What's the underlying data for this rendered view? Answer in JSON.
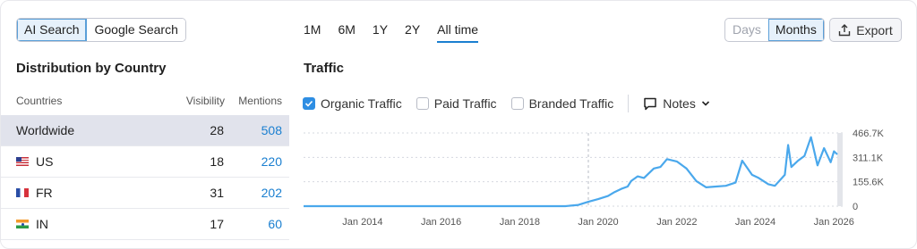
{
  "search_toggle": {
    "options": [
      "AI Search",
      "Google Search"
    ],
    "selected": "AI Search"
  },
  "left_panel": {
    "title": "Distribution by Country",
    "columns": [
      "Countries",
      "Visibility",
      "Mentions"
    ],
    "rows": [
      {
        "flag": "none",
        "country": "Worldwide",
        "visibility": "28",
        "mentions": "508",
        "selected": true
      },
      {
        "flag": "flag-us",
        "country": "US",
        "visibility": "18",
        "mentions": "220",
        "selected": false
      },
      {
        "flag": "flag-fr",
        "country": "FR",
        "visibility": "31",
        "mentions": "202",
        "selected": false
      },
      {
        "flag": "flag-in",
        "country": "IN",
        "visibility": "17",
        "mentions": "60",
        "selected": false
      }
    ]
  },
  "ranges": {
    "items": [
      "1M",
      "6M",
      "1Y",
      "2Y",
      "All time"
    ],
    "selected": "All time"
  },
  "granularity": {
    "options": [
      "Days",
      "Months"
    ],
    "selected": "Months"
  },
  "export_label": "Export",
  "traffic": {
    "title": "Traffic",
    "legend": [
      {
        "label": "Organic Traffic",
        "checked": true
      },
      {
        "label": "Paid Traffic",
        "checked": false
      },
      {
        "label": "Branded Traffic",
        "checked": false
      }
    ],
    "notes_label": "Notes"
  },
  "colors": {
    "accent": "#1a7fd0",
    "line": "#4aa8ec",
    "checkbox": "#2e8ee3"
  },
  "chart_data": {
    "type": "line",
    "title": "",
    "series": [
      {
        "name": "Organic Traffic",
        "points": [
          [
            "2012-07",
            0
          ],
          [
            "2013-06",
            0
          ],
          [
            "2014-06",
            0
          ],
          [
            "2015-06",
            0
          ],
          [
            "2016-06",
            0
          ],
          [
            "2017-06",
            0
          ],
          [
            "2018-06",
            0
          ],
          [
            "2019-03",
            0
          ],
          [
            "2019-07",
            8000
          ],
          [
            "2019-10",
            28000
          ],
          [
            "2020-01",
            45000
          ],
          [
            "2020-04",
            65000
          ],
          [
            "2020-06",
            90000
          ],
          [
            "2020-08",
            110000
          ],
          [
            "2020-10",
            125000
          ],
          [
            "2020-11",
            160000
          ],
          [
            "2021-01",
            190000
          ],
          [
            "2021-03",
            180000
          ],
          [
            "2021-06",
            240000
          ],
          [
            "2021-08",
            250000
          ],
          [
            "2021-10",
            300000
          ],
          [
            "2022-01",
            285000
          ],
          [
            "2022-04",
            240000
          ],
          [
            "2022-07",
            160000
          ],
          [
            "2022-10",
            120000
          ],
          [
            "2023-01",
            125000
          ],
          [
            "2023-04",
            130000
          ],
          [
            "2023-07",
            150000
          ],
          [
            "2023-09",
            290000
          ],
          [
            "2023-12",
            200000
          ],
          [
            "2024-02",
            180000
          ],
          [
            "2024-05",
            140000
          ],
          [
            "2024-07",
            130000
          ],
          [
            "2024-10",
            200000
          ],
          [
            "2024-11",
            390000
          ],
          [
            "2024-12",
            250000
          ],
          [
            "2025-02",
            290000
          ],
          [
            "2025-04",
            320000
          ],
          [
            "2025-06",
            440000
          ],
          [
            "2025-08",
            260000
          ],
          [
            "2025-10",
            370000
          ],
          [
            "2025-12",
            280000
          ],
          [
            "2026-01",
            350000
          ],
          [
            "2026-02",
            330000
          ]
        ]
      }
    ],
    "x_ticks": [
      "Jan 2014",
      "Jan 2016",
      "Jan 2018",
      "Jan 2020",
      "Jan 2022",
      "Jan 2024",
      "Jan 2026"
    ],
    "y_ticks": [
      "0",
      "155.6K",
      "311.1K",
      "466.7K"
    ],
    "ylim": [
      0,
      466700
    ],
    "grid": "horizontal dotted",
    "annotation_line": "Jan 2020"
  }
}
